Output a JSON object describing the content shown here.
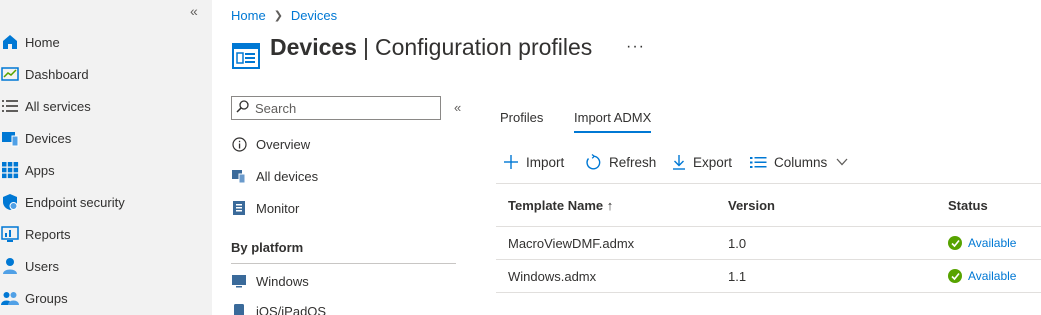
{
  "global_nav": {
    "collapse_glyph": "«",
    "items": [
      {
        "label": "Home",
        "icon": "home-icon"
      },
      {
        "label": "Dashboard",
        "icon": "dashboard-icon"
      },
      {
        "label": "All services",
        "icon": "list-icon"
      },
      {
        "label": "Devices",
        "icon": "devices-icon"
      },
      {
        "label": "Apps",
        "icon": "apps-icon"
      },
      {
        "label": "Endpoint security",
        "icon": "shield-icon"
      },
      {
        "label": "Reports",
        "icon": "reports-icon"
      },
      {
        "label": "Users",
        "icon": "user-icon"
      },
      {
        "label": "Groups",
        "icon": "groups-icon"
      }
    ]
  },
  "breadcrumb": {
    "home": "Home",
    "current": "Devices"
  },
  "header": {
    "title_bold": "Devices",
    "title_sep": "|",
    "title_rest": "Configuration profiles",
    "more": "···"
  },
  "side_nav": {
    "search_placeholder": "Search",
    "collapse_glyph": "«",
    "items": [
      {
        "label": "Overview",
        "icon": "info-icon"
      },
      {
        "label": "All devices",
        "icon": "devices-icon"
      },
      {
        "label": "Monitor",
        "icon": "monitor-icon"
      }
    ],
    "section_title": "By platform",
    "platforms": [
      {
        "label": "Windows",
        "icon": "windows-icon"
      },
      {
        "label": "iOS/iPadOS",
        "icon": "ios-icon"
      }
    ]
  },
  "tabs": [
    {
      "label": "Profiles",
      "active": false
    },
    {
      "label": "Import ADMX",
      "active": true
    }
  ],
  "commands": {
    "import": "Import",
    "refresh": "Refresh",
    "export": "Export",
    "columns": "Columns"
  },
  "table": {
    "columns": [
      "Template Name ↑",
      "Version",
      "Status"
    ],
    "rows": [
      {
        "name": "MacroViewDMF.admx",
        "version": "1.0",
        "status": "Available"
      },
      {
        "name": "Windows.admx",
        "version": "1.1",
        "status": "Available"
      }
    ]
  },
  "colors": {
    "accent": "#0078d4",
    "success": "#57a300",
    "nav_bg": "#f2f2f2"
  }
}
